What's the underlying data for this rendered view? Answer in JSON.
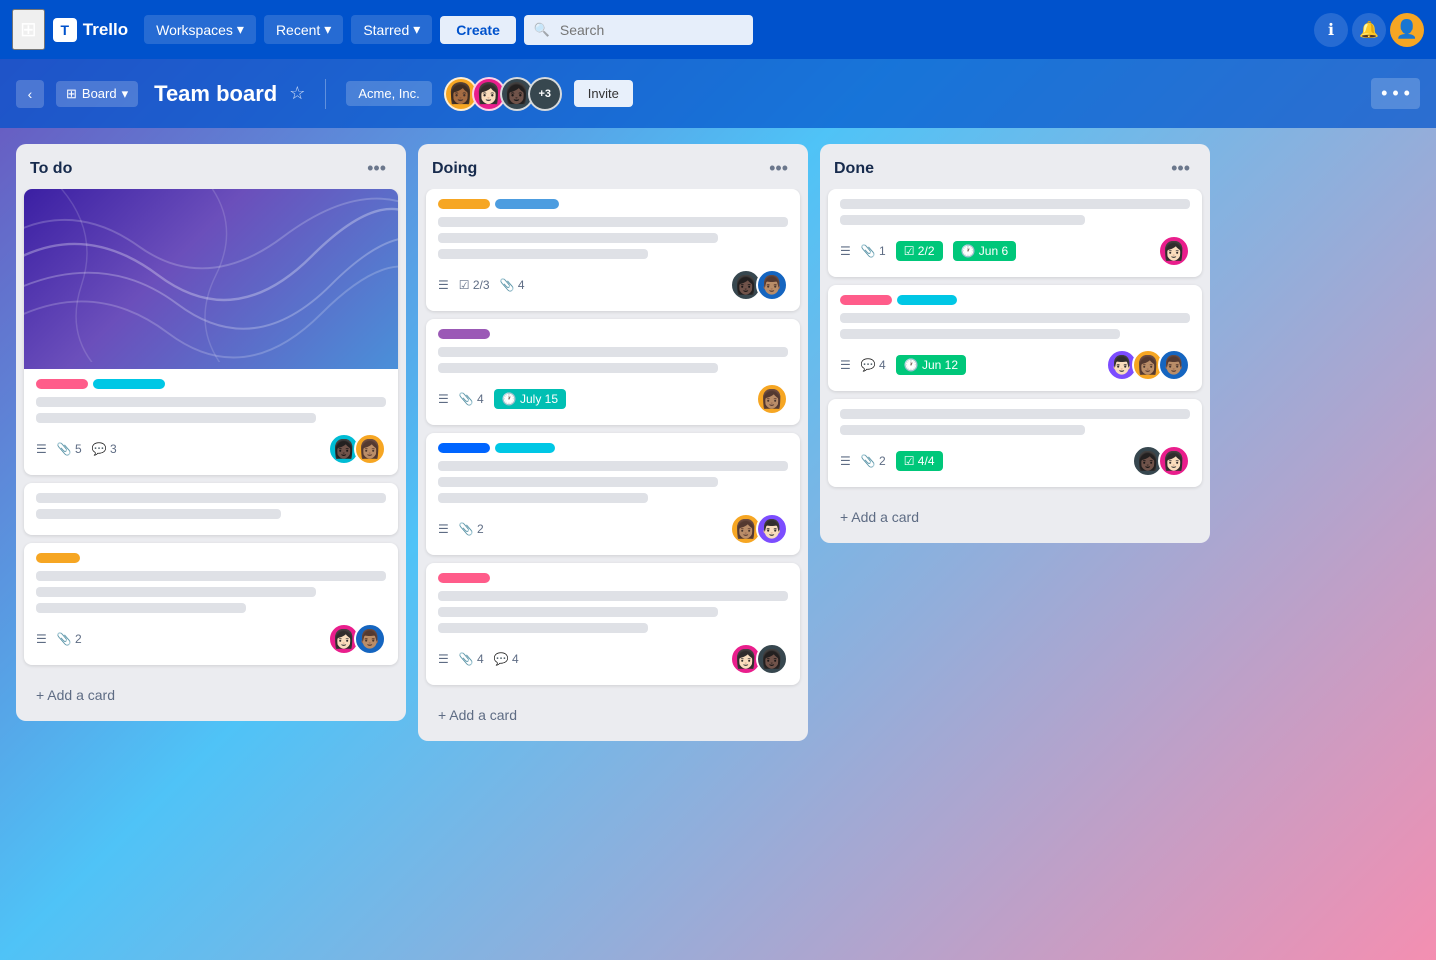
{
  "app": {
    "name": "Trello",
    "logo_symbol": "T"
  },
  "nav": {
    "workspaces_label": "Workspaces",
    "recent_label": "Recent",
    "starred_label": "Starred",
    "create_label": "Create",
    "search_placeholder": "Search",
    "info_icon": "ℹ",
    "bell_icon": "🔔"
  },
  "board_header": {
    "view_label": "Board",
    "title": "Team board",
    "workspace_label": "Acme, Inc.",
    "invite_label": "Invite",
    "more_icon": "•••",
    "member_count_extra": "+3"
  },
  "columns": [
    {
      "id": "todo",
      "title": "To do",
      "cards": [
        {
          "id": "card-1",
          "has_cover": true,
          "labels": [
            "pink",
            "cyan"
          ],
          "text_lines": [
            100,
            80,
            60
          ],
          "meta": {
            "description": true,
            "attachments": 5,
            "comments": 3
          },
          "avatars": [
            "teal",
            "yellow"
          ]
        },
        {
          "id": "card-2",
          "has_cover": false,
          "labels": [],
          "text_lines": [
            100,
            70
          ],
          "meta": {
            "description": false,
            "attachments": null,
            "comments": null
          },
          "avatars": []
        },
        {
          "id": "card-3",
          "has_cover": false,
          "labels": [
            "yellow"
          ],
          "text_lines": [
            100,
            80,
            60
          ],
          "meta": {
            "description": true,
            "attachments": 2,
            "comments": null
          },
          "avatars": [
            "pink",
            "blue"
          ]
        }
      ],
      "add_card_label": "+ Add a card"
    },
    {
      "id": "doing",
      "title": "Doing",
      "cards": [
        {
          "id": "card-4",
          "has_cover": false,
          "labels": [
            "yellow",
            "blue2"
          ],
          "text_lines": [
            100,
            80,
            60
          ],
          "meta": {
            "description": true,
            "checklist": "2/3",
            "attachments": 4
          },
          "avatars": [
            "dark",
            "blue"
          ]
        },
        {
          "id": "card-5",
          "has_cover": false,
          "labels": [
            "purple"
          ],
          "text_lines": [
            100,
            80
          ],
          "meta": {
            "description": true,
            "attachments": 4,
            "due": "July 15"
          },
          "avatars": [
            "yellow"
          ]
        },
        {
          "id": "card-6",
          "has_cover": false,
          "labels": [
            "blue",
            "cyan"
          ],
          "text_lines": [
            100,
            80,
            60
          ],
          "meta": {
            "description": true,
            "attachments": 2
          },
          "avatars": [
            "yellow",
            "purple"
          ]
        },
        {
          "id": "card-7",
          "has_cover": false,
          "labels": [
            "pink2"
          ],
          "text_lines": [
            100,
            80,
            60
          ],
          "meta": {
            "description": true,
            "attachments": 4,
            "comments": 4
          },
          "avatars": [
            "pink",
            "dark"
          ]
        }
      ],
      "add_card_label": "+ Add a card"
    },
    {
      "id": "done",
      "title": "Done",
      "cards": [
        {
          "id": "card-8",
          "has_cover": false,
          "labels": [],
          "text_lines": [
            100,
            70
          ],
          "meta": {
            "description": true,
            "attachments": 1,
            "badge_check": "2/2",
            "badge_date": "Jun 6"
          },
          "avatars": [
            "pink_light"
          ]
        },
        {
          "id": "card-9",
          "has_cover": false,
          "labels": [
            "pink3",
            "cyan3"
          ],
          "text_lines": [
            100,
            80
          ],
          "meta": {
            "description": true,
            "comments": 4,
            "badge_date": "Jun 12"
          },
          "avatars": [
            "purple",
            "yellow",
            "blue"
          ]
        },
        {
          "id": "card-10",
          "has_cover": false,
          "labels": [],
          "text_lines": [
            100,
            70
          ],
          "meta": {
            "description": true,
            "attachments": 2,
            "badge_check": "4/4"
          },
          "avatars": [
            "dark",
            "pink_light"
          ]
        }
      ],
      "add_card_label": "+ Add a card"
    }
  ]
}
